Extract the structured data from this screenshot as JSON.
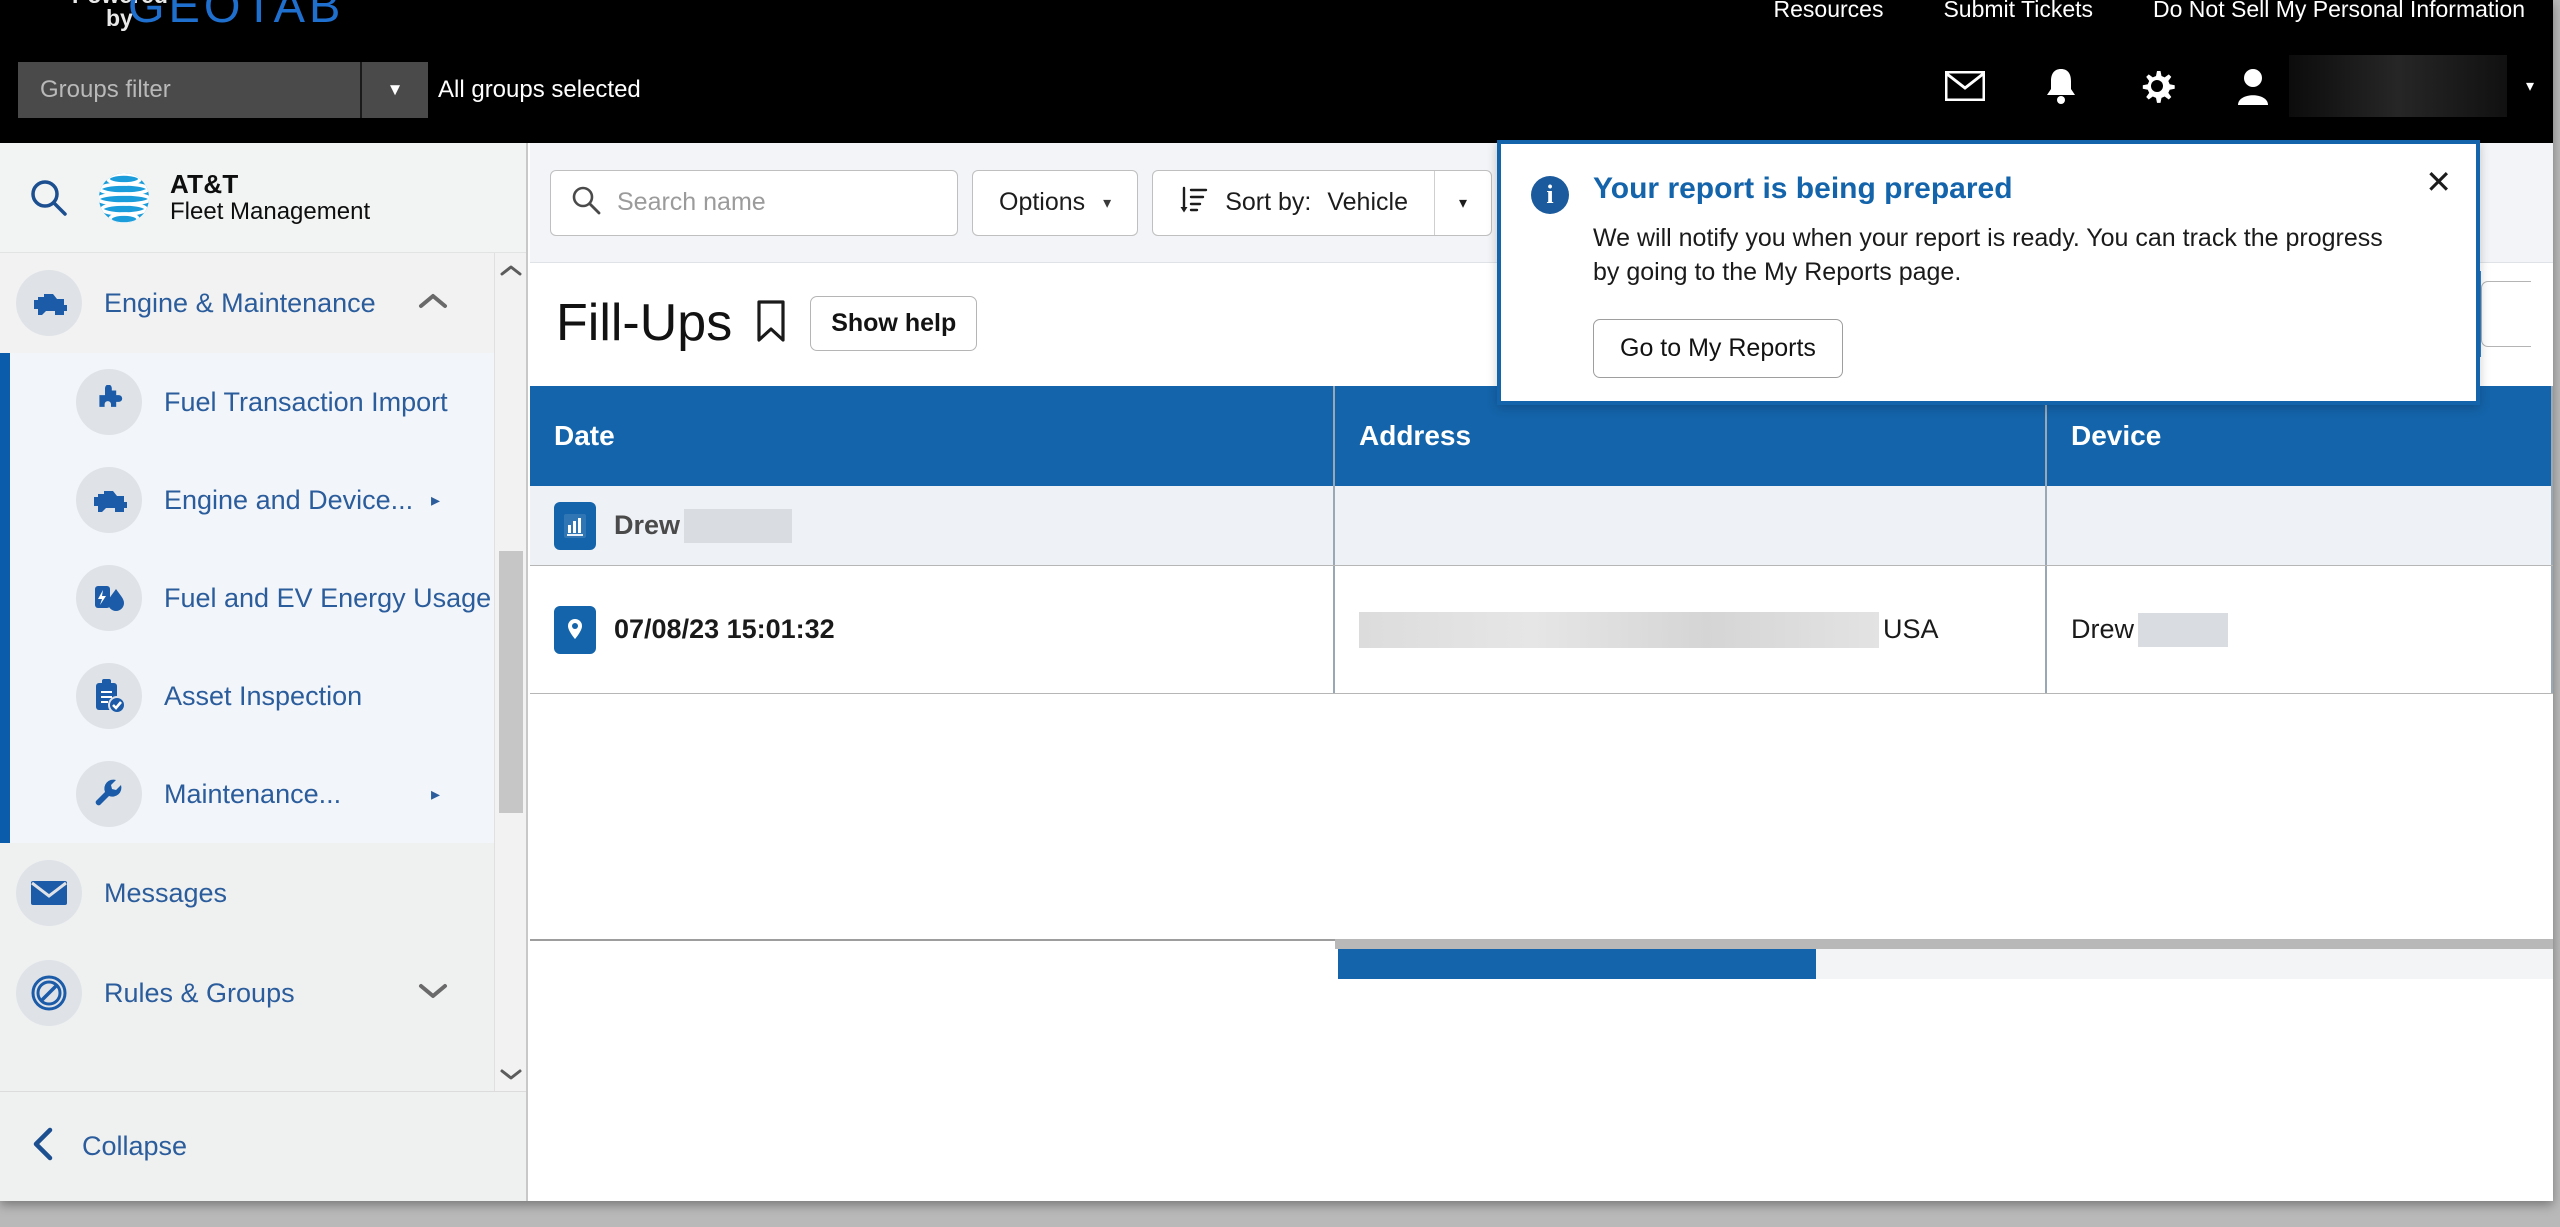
{
  "topbar": {
    "powered": "Powered",
    "by": "by",
    "brand": "GEOTAB",
    "links": [
      "Resources",
      "Submit Tickets",
      "Do Not Sell My Personal Information"
    ],
    "groups_filter_placeholder": "Groups filter",
    "all_groups_selected": "All groups selected",
    "icons": [
      "mail-icon",
      "bell-icon",
      "gear-icon",
      "user-icon"
    ],
    "user_caret": "▾"
  },
  "sidebar": {
    "brand_line1": "AT&T",
    "brand_line2": "Fleet Management",
    "search_icon": "search-icon",
    "section": {
      "label": "Engine & Maintenance",
      "icon": "engine-icon",
      "chevron": "ⱏ"
    },
    "items": [
      {
        "label": "Fuel Transaction Import",
        "icon": "puzzle-icon",
        "arrow": ""
      },
      {
        "label": "Engine and Device...",
        "icon": "engine-icon",
        "arrow": "▸"
      },
      {
        "label": "Fuel and EV Energy Usage",
        "icon": "fuel-ev-icon",
        "arrow": ""
      },
      {
        "label": "Asset Inspection",
        "icon": "clipboard-check-icon",
        "arrow": ""
      },
      {
        "label": "Maintenance...",
        "icon": "wrench-icon",
        "arrow": "▸"
      }
    ],
    "plain_items": [
      {
        "label": "Messages",
        "icon": "envelope-icon",
        "chevron": ""
      },
      {
        "label": "Rules & Groups",
        "icon": "prohibit-icon",
        "chevron": "ⱞ"
      }
    ],
    "collapse_label": "Collapse",
    "scroll_up": "ⱏ",
    "scroll_down": "ⱞ"
  },
  "toolbar": {
    "search_placeholder": "Search name",
    "search_value": "",
    "options_label": "Options",
    "sort_label": "Sort by:",
    "sort_value": "Vehicle",
    "caret": "▾"
  },
  "page": {
    "title": "Fill-Ups",
    "bookmark_icon": "bookmark-icon",
    "show_help": "Show help"
  },
  "table": {
    "columns": [
      "Date",
      "Address",
      "Device"
    ],
    "group_row": {
      "icon": "report-chart-icon",
      "label": "Drew",
      "redacted_width": 108
    },
    "data_row": {
      "icon": "map-pin-icon",
      "date": "07/08/23 15:01:32",
      "address_suffix": "USA",
      "device": "Drew",
      "device_redacted_width": 90
    }
  },
  "notification": {
    "info_icon": "info-icon",
    "title": "Your report is being prepared",
    "body": "We will notify you when your report is ready. You can track the progress by going to the My Reports page.",
    "button": "Go to My Reports",
    "close_icon": "✕",
    "accent": "#1464ab"
  }
}
